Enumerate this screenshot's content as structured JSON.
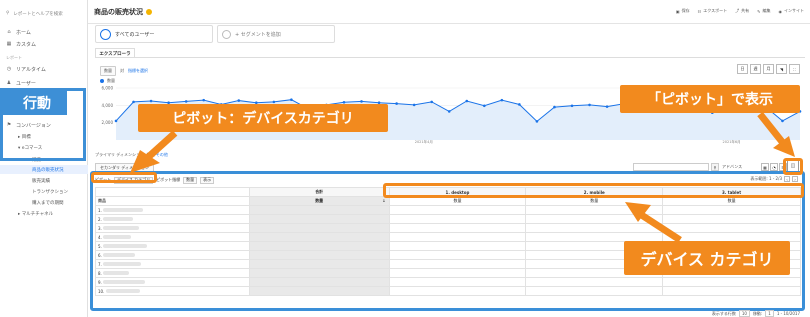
{
  "sidebar": {
    "search_placeholder": "レポートとヘルプを検索",
    "items": [
      {
        "icon": "home-icon",
        "label": "ホーム"
      },
      {
        "icon": "custom-icon",
        "label": "カスタム"
      },
      {
        "label": "レポート",
        "section": true
      },
      {
        "icon": "clock-icon",
        "label": "リアルタイム"
      },
      {
        "icon": "user-icon",
        "label": "ユーザー"
      }
    ],
    "behavior_callout": "行動",
    "conversion_label": "コンバージョン",
    "goals_label": "▸ 目標",
    "ecommerce_label": "▾ eコマース",
    "ecommerce_items": [
      "概要",
      "商品の販売状況",
      "販売実績",
      "トランザクション",
      "購入までの期間"
    ],
    "multichannel_label": "▸ マルチチャネル"
  },
  "header": {
    "title": "商品の販売状況",
    "actions": [
      "保存",
      "エクスポート",
      "共有",
      "編集",
      "インサイト"
    ]
  },
  "segments": {
    "all_users": "すべてのユーザー",
    "add_segment": "+ セグメントを追加"
  },
  "explorer_tab": "エクスプローラ",
  "metric": {
    "select": "数量",
    "vs": "対",
    "choose": "指標を選択"
  },
  "chart_legend": "数量",
  "chart_data": {
    "type": "line",
    "series": [
      {
        "name": "数量",
        "values": [
          2200,
          4400,
          4500,
          4300,
          4450,
          4600,
          4100,
          4550,
          4300,
          4400,
          4650,
          3550,
          4050,
          4350,
          4450,
          4300,
          4200,
          4050,
          4400,
          3300,
          4500,
          3950,
          4600,
          4100,
          2150,
          3800,
          3950,
          4050,
          3850,
          4200,
          4100,
          4350,
          3300,
          4000,
          3150,
          4200,
          4050,
          3900,
          2200,
          3300
        ]
      }
    ],
    "y_ticks": [
      "6,000",
      "4,000",
      "2,000"
    ],
    "ylim": [
      0,
      6000
    ],
    "grid": true
  },
  "chart_x_labels": {
    "left": "2021年4月",
    "right": "2021年6月"
  },
  "primary_dimension": {
    "label": "プライマリ ディメンション:",
    "value": "商品",
    "other": "その他"
  },
  "secondary_dimension": "セカンダリ ディメンション",
  "advanced": "アドバンス",
  "pivot": {
    "pivot_label": "ピボット",
    "pivot_by": "デバイス カテゴリ",
    "pivot_metric_label": "ピボット指標",
    "pivot_metric": "数量",
    "display_label": "表示",
    "count_label": "表示範囲: 1 - 2/3"
  },
  "table": {
    "total_header": "合計",
    "columns": [
      "1. desktop",
      "2. mobile",
      "3. tablet"
    ],
    "row_header": "商品",
    "metric_header": "数量",
    "rows": [
      "1.",
      "2.",
      "3.",
      "4.",
      "5.",
      "6.",
      "7.",
      "8.",
      "9.",
      "10."
    ]
  },
  "pager": {
    "rows_label": "表示する行数",
    "rows_value": "10",
    "goto_label": "移動:",
    "goto_value": "1",
    "range": "1 - 10/2017"
  },
  "callouts": {
    "pivot_device": "ピボット：デバイスカテゴリ",
    "pivot_display": "「ピボット」で表示",
    "device_category": "デバイス カテゴリ"
  },
  "colors": {
    "accent": "#1a73e8",
    "callout_orange": "#f28a1e",
    "callout_blue": "#3d8fd6"
  }
}
